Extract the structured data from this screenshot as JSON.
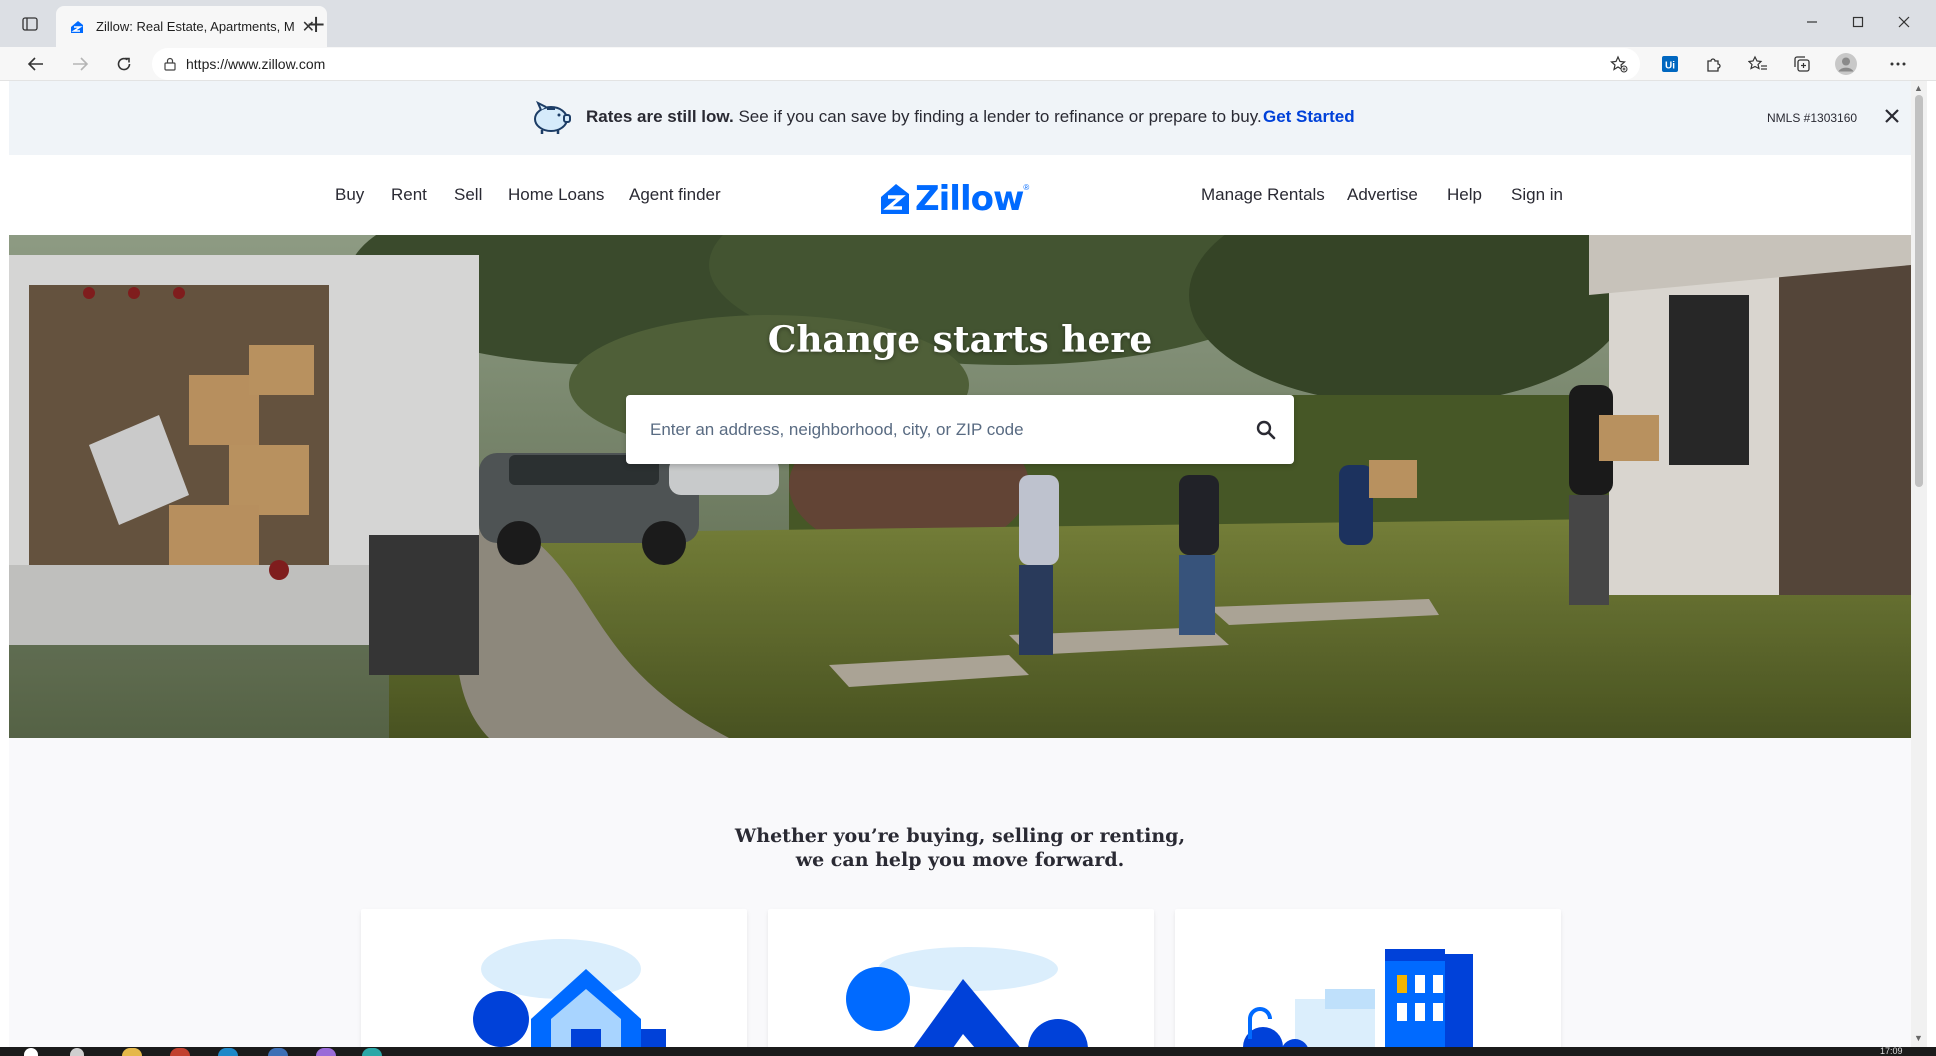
{
  "browser": {
    "tab_title": "Zillow: Real Estate, Apartments, M",
    "url": "https://www.zillow.com"
  },
  "banner": {
    "bold_text": "Rates are still low.",
    "text": " See if you can save by finding a lender to refinance or prepare to buy.",
    "cta": "Get Started",
    "nmls": "NMLS #1303160"
  },
  "nav": {
    "left": [
      "Buy",
      "Rent",
      "Sell",
      "Home Loans",
      "Agent finder"
    ],
    "logo": "Zillow",
    "right": [
      "Manage Rentals",
      "Advertise",
      "Help",
      "Sign in"
    ]
  },
  "hero": {
    "headline": "Change starts here",
    "search_placeholder": "Enter an address, neighborhood, city, or ZIP code"
  },
  "tagline": {
    "line1": "Whether you’re buying, selling or renting,",
    "line2": "we can help you move forward."
  },
  "colors": {
    "brand": "#006aff",
    "cta": "#0041d9",
    "banner_bg": "#f0f4f8"
  },
  "taskbar": {
    "clock": "17:09"
  }
}
